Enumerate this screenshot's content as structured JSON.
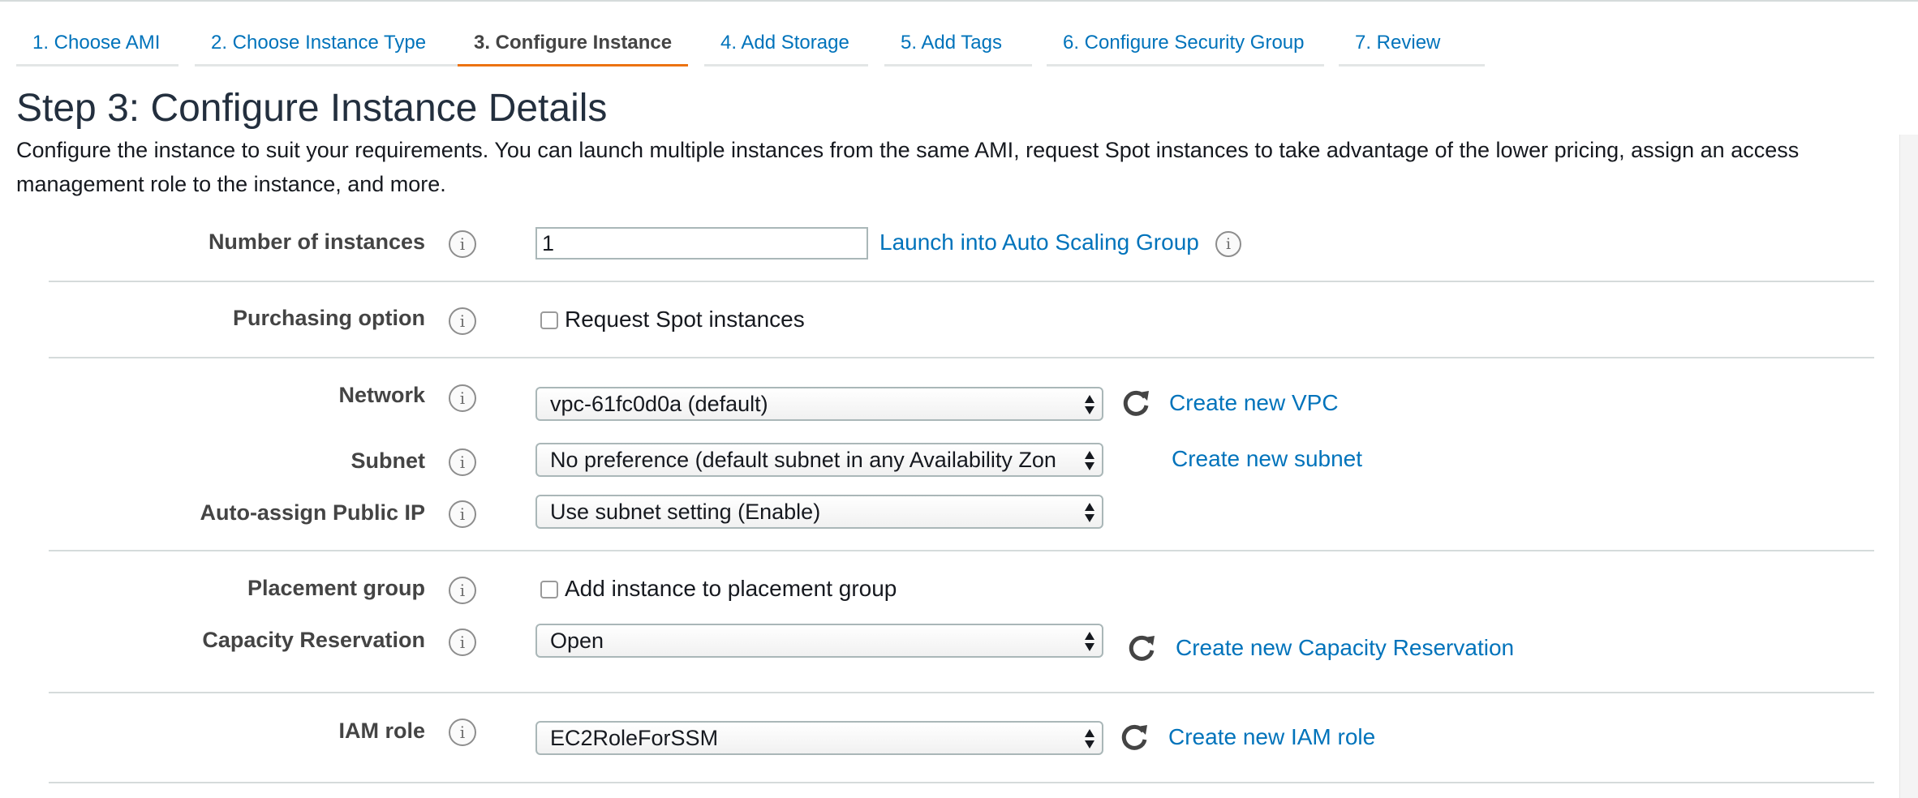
{
  "tabs": [
    {
      "label": "1. Choose AMI",
      "active": false
    },
    {
      "label": "2. Choose Instance Type",
      "active": false
    },
    {
      "label": "3. Configure Instance",
      "active": true
    },
    {
      "label": "4. Add Storage",
      "active": false
    },
    {
      "label": "5. Add Tags",
      "active": false
    },
    {
      "label": "6. Configure Security Group",
      "active": false
    },
    {
      "label": "7. Review",
      "active": false
    }
  ],
  "page": {
    "title": "Step 3: Configure Instance Details",
    "description": "Configure the instance to suit your requirements. You can launch multiple instances from the same AMI, request Spot instances to take advantage of the lower pricing, assign an access management role to the instance, and more."
  },
  "form": {
    "number_of_instances": {
      "label": "Number of instances",
      "value": "1",
      "link": "Launch into Auto Scaling Group"
    },
    "purchasing_option": {
      "label": "Purchasing option",
      "checkbox_label": "Request Spot instances",
      "checked": false
    },
    "network": {
      "label": "Network",
      "value": "vpc-61fc0d0a (default)",
      "link": "Create new VPC"
    },
    "subnet": {
      "label": "Subnet",
      "value": "No preference (default subnet in any Availability Zon",
      "link": "Create new subnet"
    },
    "auto_assign_ip": {
      "label": "Auto-assign Public IP",
      "value": "Use subnet setting (Enable)"
    },
    "placement_group": {
      "label": "Placement group",
      "checkbox_label": "Add instance to placement group",
      "checked": false
    },
    "capacity_reservation": {
      "label": "Capacity Reservation",
      "value": "Open",
      "link": "Create new Capacity Reservation"
    },
    "iam_role": {
      "label": "IAM role",
      "value": "EC2RoleForSSM",
      "link": "Create new IAM role"
    }
  },
  "icons": {
    "info": "info-icon",
    "refresh": "refresh-icon",
    "select_arrows": "select-arrows-icon"
  },
  "colors": {
    "link": "#0073bb",
    "active_tab_underline": "#ec7211",
    "label": "#444444"
  }
}
